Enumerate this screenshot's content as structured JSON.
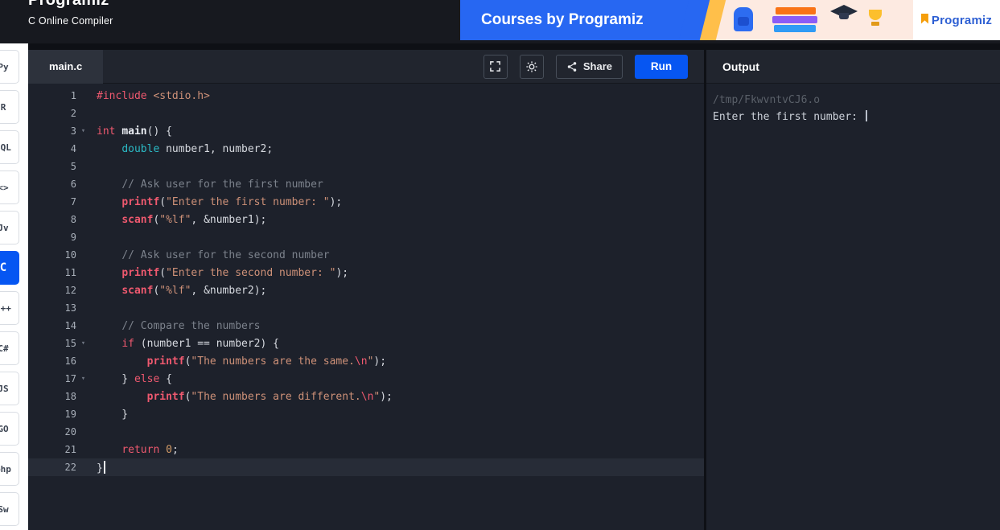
{
  "header": {
    "logo": "Programiz",
    "subtitle": "C Online Compiler",
    "banner": {
      "title": "Courses by Programiz",
      "brand": "Programiz"
    }
  },
  "sidebar": {
    "languages": [
      {
        "id": "python",
        "glyph": "Py"
      },
      {
        "id": "r",
        "glyph": "R"
      },
      {
        "id": "sql",
        "glyph": "SQL"
      },
      {
        "id": "html",
        "glyph": "<>"
      },
      {
        "id": "java",
        "glyph": "Jv"
      },
      {
        "id": "c",
        "glyph": "C",
        "active": true
      },
      {
        "id": "cpp",
        "glyph": "C++"
      },
      {
        "id": "csharp",
        "glyph": "C#"
      },
      {
        "id": "javascript",
        "glyph": "JS"
      },
      {
        "id": "go",
        "glyph": "GO"
      },
      {
        "id": "php",
        "glyph": "php"
      },
      {
        "id": "swift",
        "glyph": "Sw"
      }
    ]
  },
  "editor": {
    "tab": "main.c",
    "toolbar": {
      "run_label": "Run",
      "share_label": "Share"
    },
    "lines": [
      {
        "n": 1,
        "tokens": [
          [
            "kw",
            "#include"
          ],
          [
            "pl",
            " "
          ],
          [
            "str",
            "<stdio.h>"
          ]
        ]
      },
      {
        "n": 2,
        "tokens": []
      },
      {
        "n": 3,
        "fold": true,
        "tokens": [
          [
            "kw",
            "int"
          ],
          [
            "pl",
            " "
          ],
          [
            "def",
            "main"
          ],
          [
            "pl",
            "() {"
          ]
        ]
      },
      {
        "n": 4,
        "tokens": [
          [
            "pl",
            "    "
          ],
          [
            "type",
            "double"
          ],
          [
            "pl",
            " number1, number2;"
          ]
        ]
      },
      {
        "n": 5,
        "tokens": []
      },
      {
        "n": 6,
        "tokens": [
          [
            "pl",
            "    "
          ],
          [
            "com",
            "// Ask user for the first number"
          ]
        ]
      },
      {
        "n": 7,
        "tokens": [
          [
            "pl",
            "    "
          ],
          [
            "fn",
            "printf"
          ],
          [
            "pl",
            "("
          ],
          [
            "str",
            "\"Enter the first number: \""
          ],
          [
            "pl",
            ");"
          ]
        ]
      },
      {
        "n": 8,
        "tokens": [
          [
            "pl",
            "    "
          ],
          [
            "fn",
            "scanf"
          ],
          [
            "pl",
            "("
          ],
          [
            "str",
            "\"%lf\""
          ],
          [
            "pl",
            ", &number1);"
          ]
        ]
      },
      {
        "n": 9,
        "tokens": []
      },
      {
        "n": 10,
        "tokens": [
          [
            "pl",
            "    "
          ],
          [
            "com",
            "// Ask user for the second number"
          ]
        ]
      },
      {
        "n": 11,
        "tokens": [
          [
            "pl",
            "    "
          ],
          [
            "fn",
            "printf"
          ],
          [
            "pl",
            "("
          ],
          [
            "str",
            "\"Enter the second number: \""
          ],
          [
            "pl",
            ");"
          ]
        ]
      },
      {
        "n": 12,
        "tokens": [
          [
            "pl",
            "    "
          ],
          [
            "fn",
            "scanf"
          ],
          [
            "pl",
            "("
          ],
          [
            "str",
            "\"%lf\""
          ],
          [
            "pl",
            ", &number2);"
          ]
        ]
      },
      {
        "n": 13,
        "tokens": []
      },
      {
        "n": 14,
        "tokens": [
          [
            "pl",
            "    "
          ],
          [
            "com",
            "// Compare the numbers"
          ]
        ]
      },
      {
        "n": 15,
        "fold": true,
        "tokens": [
          [
            "pl",
            "    "
          ],
          [
            "kw",
            "if"
          ],
          [
            "pl",
            " (number1 == number2) {"
          ]
        ]
      },
      {
        "n": 16,
        "tokens": [
          [
            "pl",
            "        "
          ],
          [
            "fn",
            "printf"
          ],
          [
            "pl",
            "("
          ],
          [
            "str",
            "\"The numbers are the same."
          ],
          [
            "esc",
            "\\n"
          ],
          [
            "str",
            "\""
          ],
          [
            "pl",
            ");"
          ]
        ]
      },
      {
        "n": 17,
        "fold": true,
        "tokens": [
          [
            "pl",
            "    } "
          ],
          [
            "kw",
            "else"
          ],
          [
            "pl",
            " {"
          ]
        ]
      },
      {
        "n": 18,
        "tokens": [
          [
            "pl",
            "        "
          ],
          [
            "fn",
            "printf"
          ],
          [
            "pl",
            "("
          ],
          [
            "str",
            "\"The numbers are different."
          ],
          [
            "esc",
            "\\n"
          ],
          [
            "str",
            "\""
          ],
          [
            "pl",
            ");"
          ]
        ]
      },
      {
        "n": 19,
        "tokens": [
          [
            "pl",
            "    }"
          ]
        ]
      },
      {
        "n": 20,
        "tokens": []
      },
      {
        "n": 21,
        "tokens": [
          [
            "pl",
            "    "
          ],
          [
            "kw",
            "return"
          ],
          [
            "pl",
            " "
          ],
          [
            "num",
            "0"
          ],
          [
            "pl",
            ";"
          ]
        ]
      },
      {
        "n": 22,
        "current": true,
        "cursor": true,
        "tokens": [
          [
            "pl",
            "}"
          ]
        ]
      }
    ]
  },
  "output": {
    "title": "Output",
    "lines": [
      {
        "text": "/tmp/FkwvntvCJ6.o",
        "style": "dim"
      },
      {
        "text": "Enter the first number: ",
        "style": "normal",
        "cursor": true
      }
    ]
  },
  "colors": {
    "accent_blue": "#0656f2",
    "banner_blue": "#2767f2",
    "logo_blue": "#2d5fd3",
    "flag_orange": "#f59e0b"
  }
}
